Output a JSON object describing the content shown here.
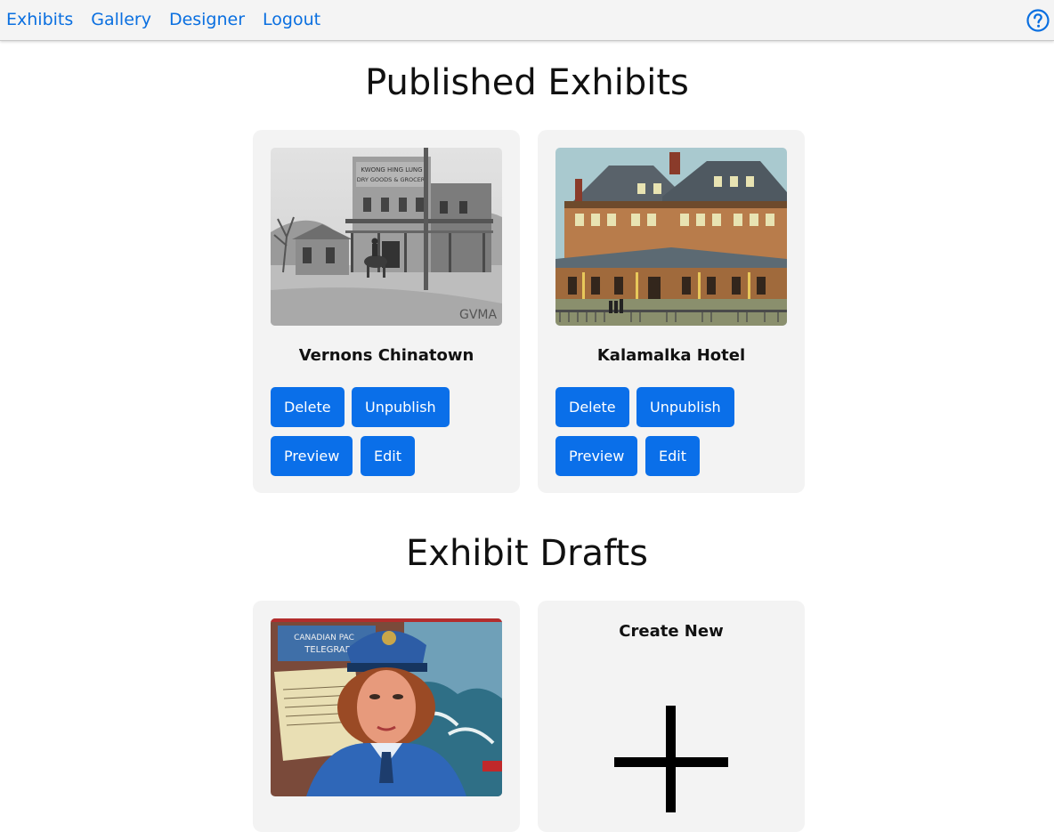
{
  "nav": {
    "links": [
      "Exhibits",
      "Gallery",
      "Designer",
      "Logout"
    ],
    "help_icon": "question-circle-icon",
    "link_color": "#0a6fe0"
  },
  "published": {
    "title": "Published Exhibits",
    "cards": [
      {
        "title": "Vernons Chinatown",
        "image": "black-and-white photo of Kwong Hing Lung dry goods store",
        "image_watermark": "GVMA",
        "buttons": [
          "Delete",
          "Unpublish",
          "Preview",
          "Edit"
        ]
      },
      {
        "title": "Kalamalka Hotel",
        "image": "colorized postcard of large Victorian hotel",
        "buttons": [
          "Delete",
          "Unpublish",
          "Preview",
          "Edit"
        ]
      }
    ]
  },
  "drafts": {
    "title": "Exhibit Drafts",
    "cards": [
      {
        "image": "mural of woman in blue uniform with Canadian Pacific Telegraph sign",
        "image_sign_text": [
          "CANADIAN PAC",
          "TELEGRAP"
        ]
      }
    ],
    "create_new": {
      "label": "Create New",
      "icon": "plus-icon"
    }
  },
  "colors": {
    "button": "#0a6fe9",
    "card_bg": "#f3f3f3"
  }
}
